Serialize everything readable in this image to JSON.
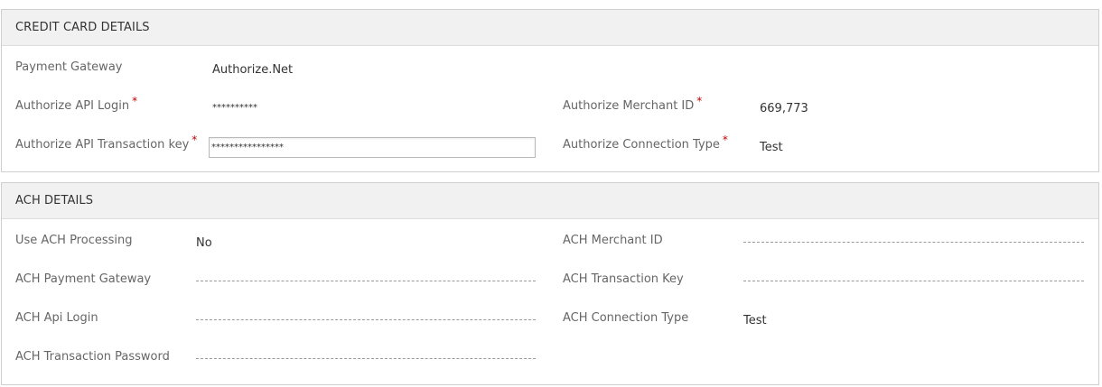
{
  "credit_card": {
    "header": "CREDIT CARD DETAILS",
    "payment_gateway": {
      "label": "Payment Gateway",
      "value": "Authorize.Net"
    },
    "api_login": {
      "label": "Authorize API Login",
      "required": "*",
      "value": "**********"
    },
    "merchant_id": {
      "label": "Authorize Merchant ID",
      "required": "*",
      "value": "669,773"
    },
    "transaction_key": {
      "label": "Authorize API Transaction key",
      "required": "*",
      "value": "****************"
    },
    "connection_type": {
      "label": "Authorize Connection Type",
      "required": "*",
      "value": "Test"
    }
  },
  "ach": {
    "header": "ACH DETAILS",
    "use_processing": {
      "label": "Use ACH Processing",
      "value": "No"
    },
    "merchant_id": {
      "label": "ACH Merchant ID",
      "value": ""
    },
    "payment_gateway": {
      "label": "ACH Payment Gateway",
      "value": ""
    },
    "transaction_key": {
      "label": "ACH Transaction Key",
      "value": ""
    },
    "api_login": {
      "label": "ACH Api Login",
      "value": ""
    },
    "connection_type": {
      "label": "ACH Connection Type",
      "value": "Test"
    },
    "transaction_password": {
      "label": "ACH Transaction Password",
      "value": ""
    }
  },
  "colors": {
    "header_bg": "#f1f1f1",
    "required": "#c00000",
    "border": "#cfcfcf"
  }
}
